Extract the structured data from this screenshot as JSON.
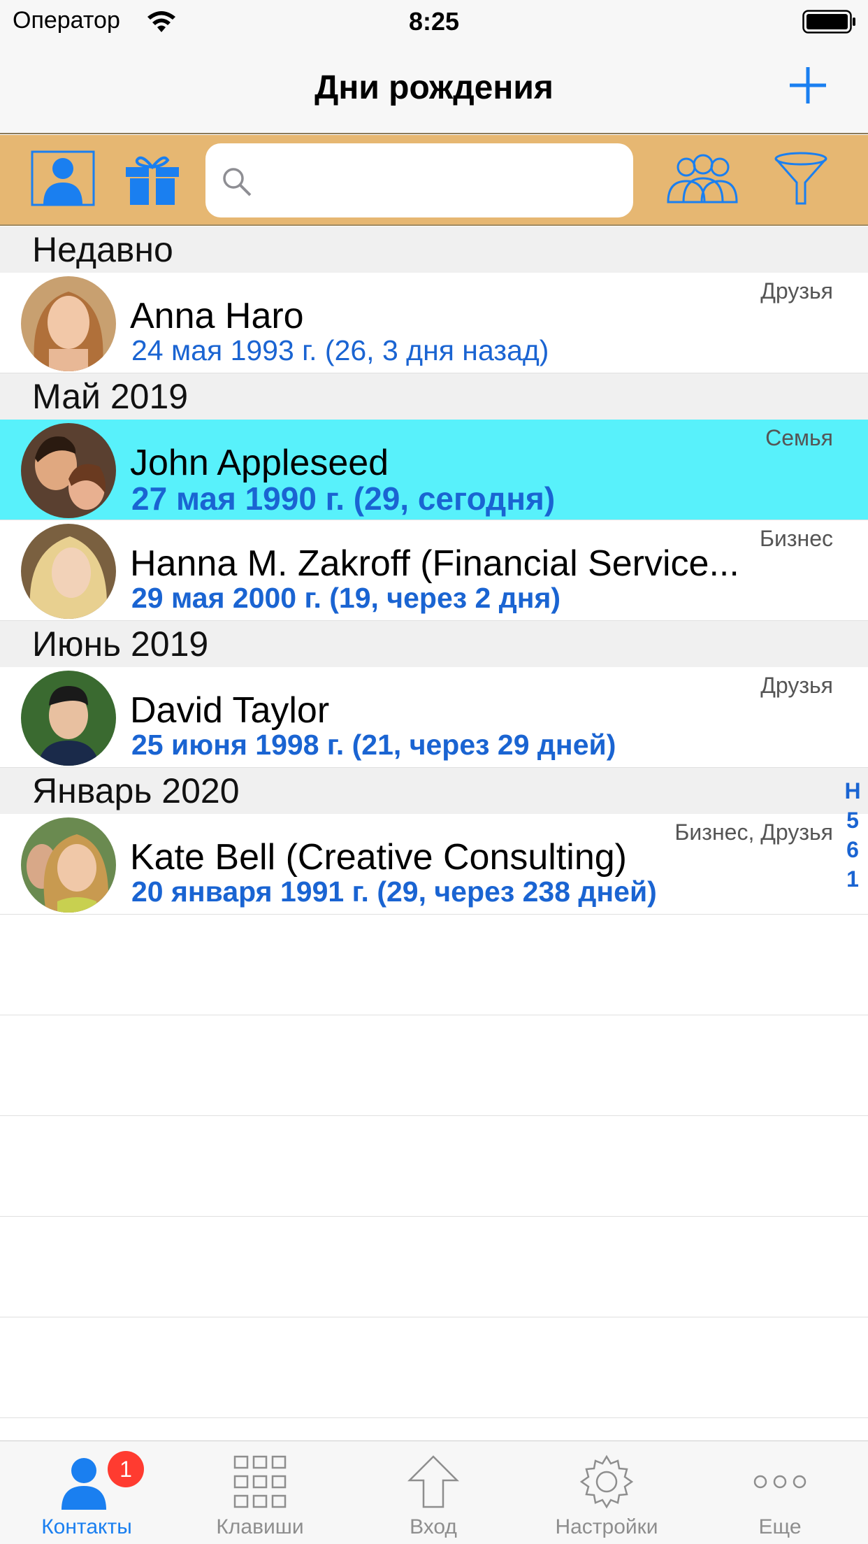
{
  "status": {
    "carrier": "Оператор",
    "time": "8:25"
  },
  "nav": {
    "title": "Дни рождения",
    "add_icon": "plus-icon"
  },
  "toolbar": {
    "search_placeholder": "",
    "accent": "#1a7ff0",
    "background": "#e6b772"
  },
  "sections": [
    {
      "title": "Недавно",
      "rows": [
        {
          "name": "Anna Haro",
          "date": "24 мая 1993 г. (26, 3 дня назад)",
          "group": "Друзья"
        }
      ]
    },
    {
      "title": "Май 2019",
      "rows": [
        {
          "name": "John Appleseed",
          "date": "27 мая 1990 г. (29, сегодня)",
          "group": "Семья"
        },
        {
          "name": "Hanna M. Zakroff (Financial Service...",
          "date": "29 мая 2000 г. (19, через 2 дня)",
          "group": "Бизнес"
        }
      ]
    },
    {
      "title": "Июнь 2019",
      "rows": [
        {
          "name": "David Taylor",
          "date": "25 июня 1998 г. (21, через 29 дней)",
          "group": "Друзья"
        }
      ]
    },
    {
      "title": "Январь 2020",
      "rows": [
        {
          "name": "Kate Bell (Creative Consulting)",
          "date": "20 января 1991 г. (29, через 238 дней)",
          "group": "Бизнес, Друзья"
        }
      ]
    }
  ],
  "section_index": [
    "Н",
    "5",
    "6",
    "1"
  ],
  "tabs": [
    {
      "label": "Контакты",
      "badge": "1"
    },
    {
      "label": "Клавиши"
    },
    {
      "label": "Вход"
    },
    {
      "label": "Настройки"
    },
    {
      "label": "Еще"
    }
  ],
  "colors": {
    "selected_row": "#58f1fb",
    "date_text": "#1a64d2",
    "tab_active": "#1a7ff0"
  }
}
